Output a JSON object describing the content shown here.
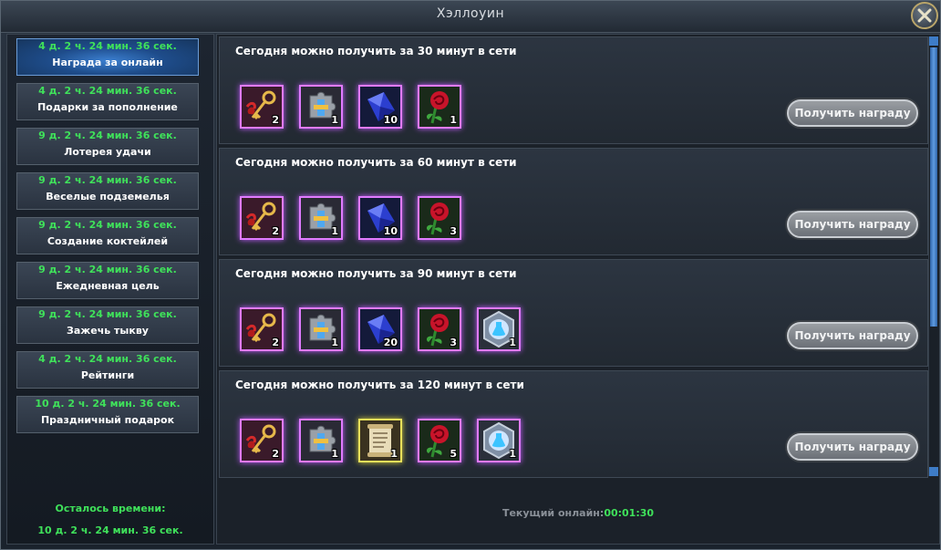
{
  "window": {
    "title": "Хэллоуин"
  },
  "sidebar": {
    "items": [
      {
        "timer": "4 д. 2 ч. 24 мин. 36 сек.",
        "label": "Награда за онлайн"
      },
      {
        "timer": "4 д. 2 ч. 24 мин. 36 сек.",
        "label": "Подарки за пополнение"
      },
      {
        "timer": "9 д. 2 ч. 24 мин. 36 сек.",
        "label": "Лотерея удачи"
      },
      {
        "timer": "9 д. 2 ч. 24 мин. 36 сек.",
        "label": "Веселые подземелья"
      },
      {
        "timer": "9 д. 2 ч. 24 мин. 36 сек.",
        "label": "Создание коктейлей"
      },
      {
        "timer": "9 д. 2 ч. 24 мин. 36 сек.",
        "label": "Ежедневная цель"
      },
      {
        "timer": "9 д. 2 ч. 24 мин. 36 сек.",
        "label": "Зажечь тыкву"
      },
      {
        "timer": "4 д. 2 ч. 24 мин. 36 сек.",
        "label": "Рейтинги"
      },
      {
        "timer": "10 д. 2 ч. 24 мин. 36 сек.",
        "label": "Праздничный подарок"
      }
    ],
    "active_index": 0,
    "remaining_label": "Осталось времени:",
    "remaining_value": "10 д. 2 ч. 24 мин. 36 сек."
  },
  "rewards": [
    {
      "title": "Сегодня можно получить за 30 минут в сети",
      "items": [
        {
          "icon": "key-icon",
          "count": "2"
        },
        {
          "icon": "puzzle-icon",
          "count": "1"
        },
        {
          "icon": "crystal-icon",
          "count": "10"
        },
        {
          "icon": "rose-icon",
          "count": "1"
        }
      ],
      "button": "Получить награду"
    },
    {
      "title": "Сегодня можно получить за 60 минут в сети",
      "items": [
        {
          "icon": "key-icon",
          "count": "2"
        },
        {
          "icon": "puzzle-icon",
          "count": "1"
        },
        {
          "icon": "crystal-icon",
          "count": "10"
        },
        {
          "icon": "rose-icon",
          "count": "3"
        }
      ],
      "button": "Получить награду"
    },
    {
      "title": "Сегодня можно получить за 90 минут в сети",
      "items": [
        {
          "icon": "key-icon",
          "count": "2"
        },
        {
          "icon": "puzzle-icon",
          "count": "1"
        },
        {
          "icon": "crystal-icon",
          "count": "20"
        },
        {
          "icon": "rose-icon",
          "count": "3"
        },
        {
          "icon": "potion-icon",
          "count": "1"
        }
      ],
      "button": "Получить награду"
    },
    {
      "title": "Сегодня можно получить за 120 минут в сети",
      "items": [
        {
          "icon": "key-icon",
          "count": "2"
        },
        {
          "icon": "puzzle-icon",
          "count": "1"
        },
        {
          "icon": "scroll-icon",
          "count": "1"
        },
        {
          "icon": "rose-icon",
          "count": "5"
        },
        {
          "icon": "potion-icon",
          "count": "1"
        }
      ],
      "button": "Получить награду"
    }
  ],
  "footer": {
    "online_label": "Текущий онлайн:",
    "online_value": "00:01:30"
  },
  "colors": {
    "timer_green": "#3fe15a",
    "item_border_purple": "#e17bff",
    "item_border_gold": "#e8e05a",
    "active_tab_blue": "#3b7fd0"
  }
}
